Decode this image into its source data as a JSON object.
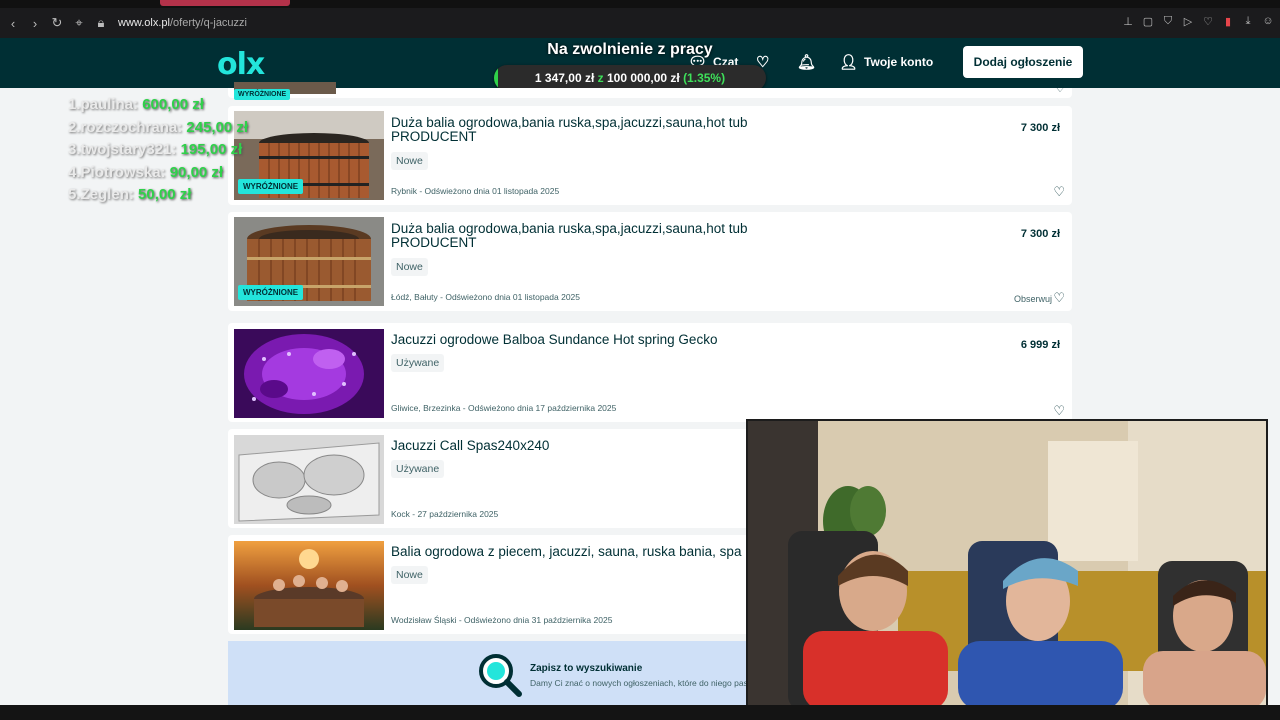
{
  "browser": {
    "url_host": "www.olx.pl",
    "url_path": "/oferty/q-jacuzzi"
  },
  "header": {
    "logo": "olx",
    "chat_label": "Czat",
    "account_label": "Twoje konto",
    "add_label": "Dodaj ogłoszenie"
  },
  "goal": {
    "title": "Na zwolnienie z pracy",
    "current": "1 347,00 zł",
    "sep": "z",
    "target": "100 000,00 zł",
    "percent": "(1.35%)",
    "fraction": 0.0135,
    "accent": "#2fd14a"
  },
  "donors": [
    {
      "rank": "1.",
      "name": "paulina",
      "amount": "600,00 zł"
    },
    {
      "rank": "2.",
      "name": "rozczochrana",
      "amount": "245,00 zł"
    },
    {
      "rank": "3.",
      "name": "twojstary321",
      "amount": "195,00 zł"
    },
    {
      "rank": "4.",
      "name": "Piotrowska",
      "amount": "90,00 zł"
    },
    {
      "rank": "5.",
      "name": "Zeglen",
      "amount": "50,00 zł"
    }
  ],
  "listings": {
    "partial_ribbon": "WYRÓŻNIONE",
    "items": [
      {
        "title": "Duża balia ogrodowa,bania ruska,spa,jacuzzi,sauna,hot tub PRODUCENT",
        "condition": "Nowe",
        "location": "Rybnik - Odświeżono dnia 01 listopada 2025",
        "price": "7 300 zł",
        "ribbon": "WYRÓŻNIONE"
      },
      {
        "title": "Duża balia ogrodowa,bania ruska,spa,jacuzzi,sauna,hot tub PRODUCENT",
        "condition": "Nowe",
        "location": "Łódź, Bałuty - Odświeżono dnia 01 listopada 2025",
        "price": "7 300 zł",
        "ribbon": "WYRÓŻNIONE",
        "observe": "Obserwuj"
      },
      {
        "title": "Jacuzzi ogrodowe Balboa Sundance Hot spring Gecko",
        "condition": "Używane",
        "location": "Gliwice, Brzezinka - Odświeżono dnia 17 października 2025",
        "price": "6 999 zł"
      },
      {
        "title": "Jacuzzi Call Spas240x240",
        "condition": "Używane",
        "location": "Kock - 27 października 2025"
      },
      {
        "title": "Balia ogrodowa z piecem, jacuzzi, sauna, ruska bania, spa",
        "condition": "Nowe",
        "location": "Wodzisław Śląski - Odświeżono dnia 31 października 2025"
      }
    ]
  },
  "save_search": {
    "title": "Zapisz to wyszukiwanie",
    "subtitle": "Damy Ci znać o nowych ogłoszeniach, które do niego pas"
  }
}
